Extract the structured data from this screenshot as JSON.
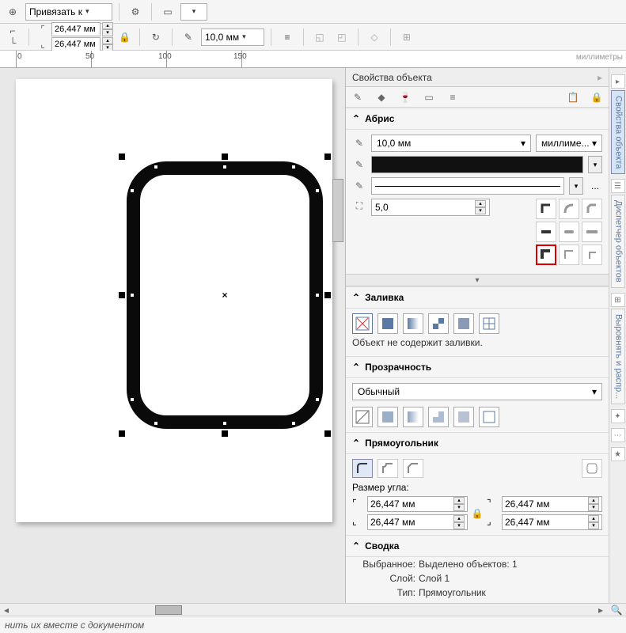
{
  "toolbar": {
    "snap_label": "Привязать к",
    "corner_w": "26,447 мм",
    "corner_h": "26,447 мм",
    "outline_width": "10,0 мм"
  },
  "ruler": {
    "ticks": [
      "0",
      "50",
      "100",
      "150"
    ],
    "units": "миллиметры"
  },
  "panel": {
    "title": "Свойства объекта",
    "outline": {
      "header": "Абрис",
      "width": "10,0 мм",
      "units": "миллиме...",
      "miter": "5,0",
      "ellipsis": "..."
    },
    "fill": {
      "header": "Заливка",
      "note": "Объект не содержит заливки."
    },
    "transparency": {
      "header": "Прозрачность",
      "mode": "Обычный"
    },
    "rect": {
      "header": "Прямоугольник",
      "corner_label": "Размер угла:",
      "tl": "26,447 мм",
      "bl": "26,447 мм",
      "tr": "26,447 мм",
      "br": "26,447 мм"
    },
    "summary": {
      "header": "Сводка",
      "selected_lbl": "Выбранное:",
      "selected_val": "Выделено объектов: 1",
      "layer_lbl": "Слой:",
      "layer_val": "Слой 1",
      "type_lbl": "Тип:",
      "type_val": "Прямоугольник"
    }
  },
  "vtabs": {
    "props": "Свойства объекта",
    "manager": "Диспетчер объектов",
    "align": "Выровнять и распр..."
  },
  "status": {
    "text": "нить их вместе с документом"
  }
}
